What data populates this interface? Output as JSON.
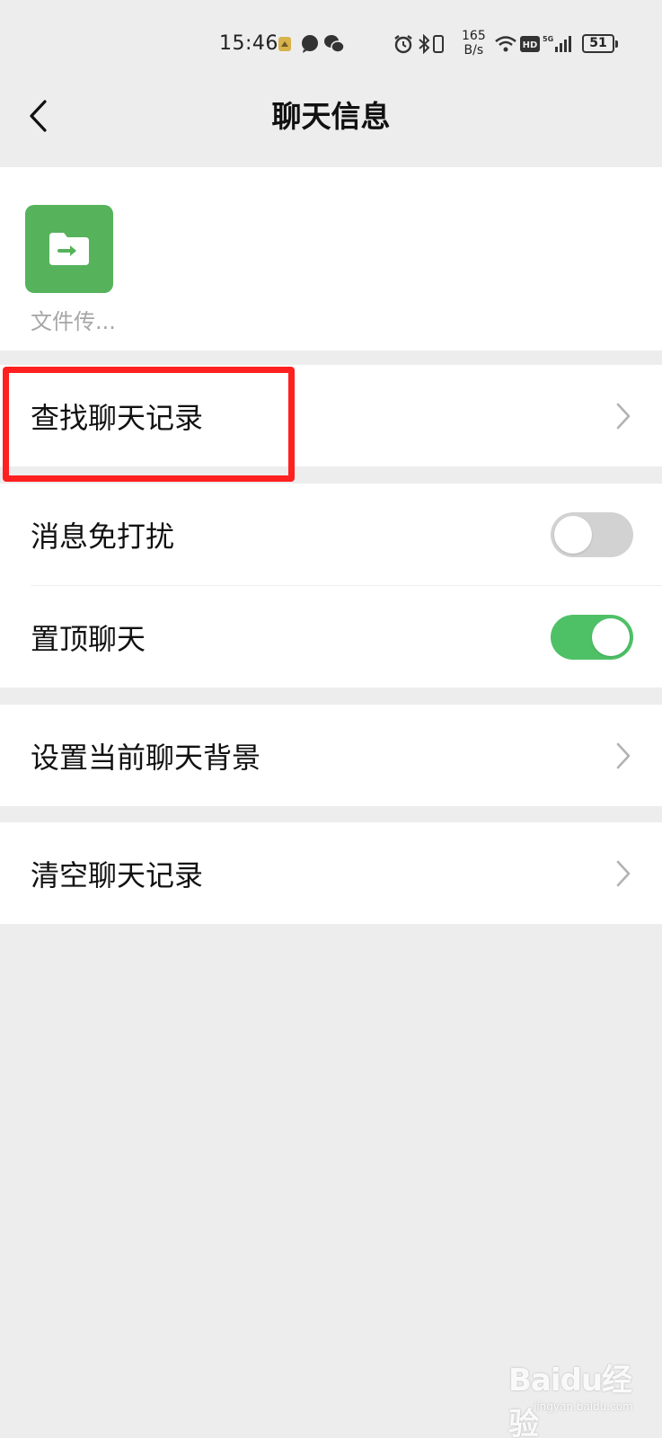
{
  "status_bar": {
    "time": "15:46",
    "speed_value": "165",
    "speed_unit": "B/s",
    "hd": "HD",
    "network": "5G",
    "battery": "51",
    "icons": [
      "notification-app-icon",
      "chat-bubble-icon",
      "wechat-icon",
      "alarm-icon",
      "bluetooth-icon",
      "vibrate-icon",
      "wifi-icon",
      "hd-icon",
      "signal-icon",
      "battery-icon"
    ]
  },
  "nav": {
    "title": "聊天信息",
    "back_icon": "chevron-left-icon"
  },
  "member": {
    "name": "文件传...",
    "avatar_icon": "folder-transfer-icon",
    "avatar_color": "#56b35b"
  },
  "rows": {
    "search_history": {
      "label": "查找聊天记录",
      "icon": "chevron-right-icon"
    },
    "mute": {
      "label": "消息免打扰",
      "enabled": false
    },
    "pin": {
      "label": "置顶聊天",
      "enabled": true
    },
    "background": {
      "label": "设置当前聊天背景",
      "icon": "chevron-right-icon"
    },
    "clear_history": {
      "label": "清空聊天记录",
      "icon": "chevron-right-icon"
    }
  },
  "colors": {
    "accent_green": "#4ec167",
    "highlight_red": "#ff2020",
    "background": "#ededed"
  },
  "watermark": {
    "logo": "Baidu经验",
    "url": "jingyan.baidu.com"
  }
}
